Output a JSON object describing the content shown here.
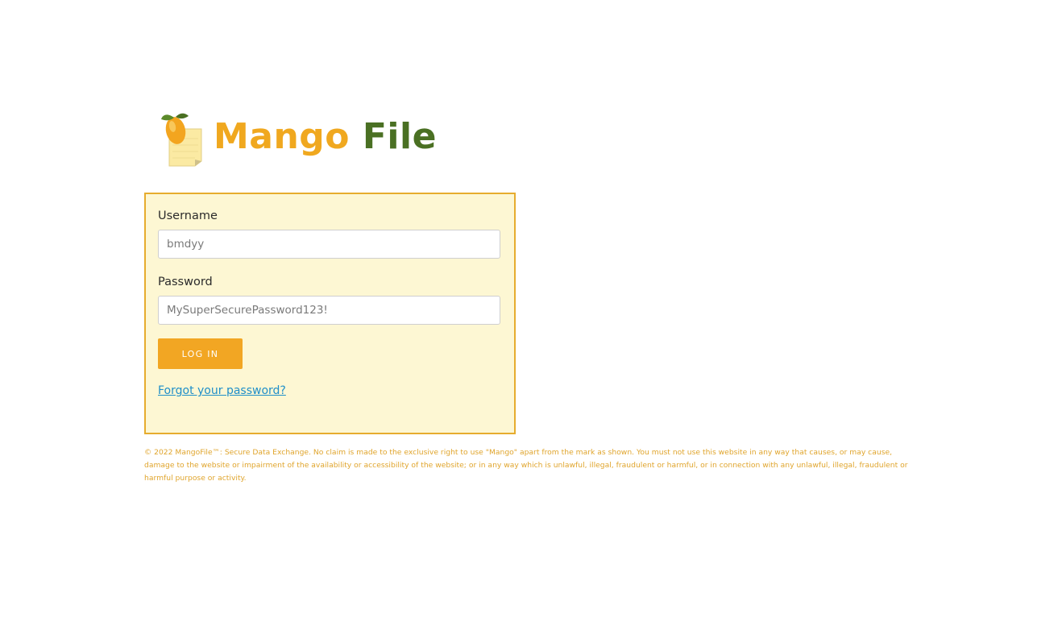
{
  "brand": {
    "word1": "Mango",
    "word2": "File",
    "mark_icon": "mango-on-note-icon",
    "color_primary": "#f0a81f",
    "color_secondary": "#4a7023"
  },
  "login": {
    "username_label": "Username",
    "username_placeholder": "bmdyy",
    "password_label": "Password",
    "password_placeholder": "MySuperSecurePassword123!",
    "submit_label": "LOG IN",
    "forgot_label": "Forgot your password?",
    "panel_bg": "#fdf7d3",
    "panel_border": "#e6ac2e",
    "button_color": "#f2a623",
    "link_color": "#1f8fc9"
  },
  "footer": {
    "text": "© 2022 MangoFile™: Secure Data Exchange. No claim is made to the exclusive right to use \"Mango\" apart from the mark as shown. You must not use this website in any way that causes, or may cause, damage to the website or impairment of the availability or accessibility of the website; or in any way which is unlawful, illegal, fraudulent or harmful, or in connection with any unlawful, illegal, fraudulent or harmful purpose or activity.",
    "color": "#e0a52d"
  }
}
